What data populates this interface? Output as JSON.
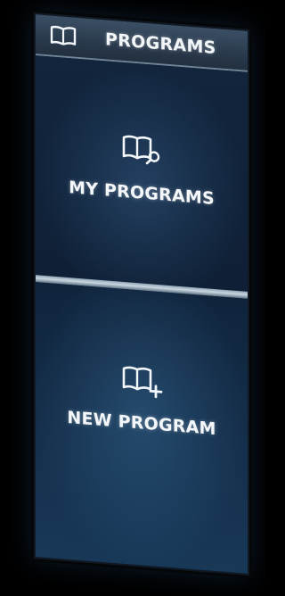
{
  "header": {
    "title": "PROGRAMS",
    "icon": "book-icon"
  },
  "tiles": [
    {
      "label": "MY PROGRAMS",
      "icon": "book-search-icon"
    },
    {
      "label": "NEW PROGRAM",
      "icon": "book-add-icon"
    }
  ],
  "colors": {
    "header_bg": "#2f4155",
    "tile_bg": "#12253d",
    "divider": "#c9d6e0",
    "text": "#f4f7fa"
  }
}
